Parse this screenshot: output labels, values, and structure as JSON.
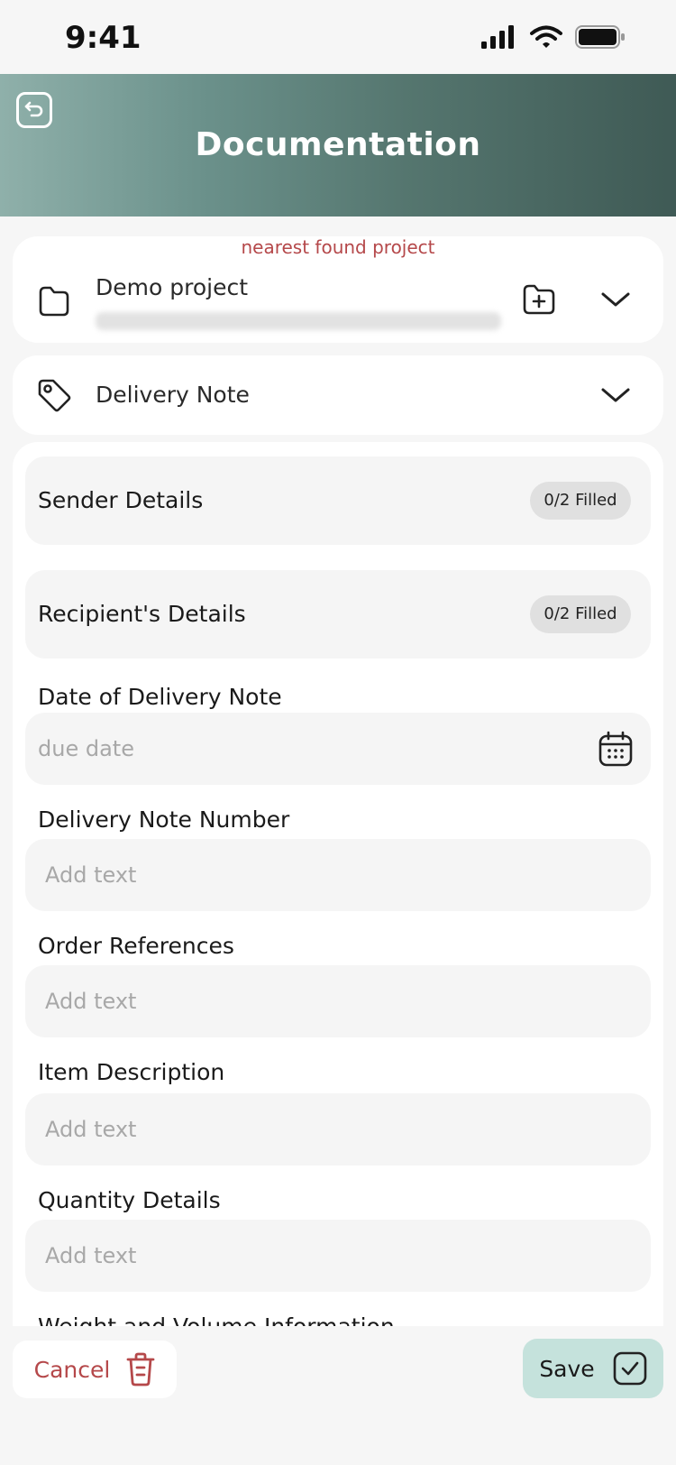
{
  "status_bar": {
    "time": "9:41"
  },
  "header": {
    "title": "Documentation"
  },
  "project": {
    "hint": "nearest found project",
    "name": "Demo project"
  },
  "category": {
    "name": "Delivery Note"
  },
  "sections": [
    {
      "title": "Sender Details",
      "badge": "0/2 Filled"
    },
    {
      "title": "Recipient's Details",
      "badge": "0/2 Filled"
    }
  ],
  "fields": {
    "date": {
      "label": "Date of Delivery Note",
      "placeholder": "due date"
    },
    "number": {
      "label": "Delivery Note Number",
      "placeholder": "Add text"
    },
    "order": {
      "label": "Order References",
      "placeholder": "Add text"
    },
    "item": {
      "label": "Item Description",
      "placeholder": "Add text"
    },
    "quantity": {
      "label": "Quantity Details",
      "placeholder": "Add text"
    },
    "weight": {
      "label": "Weight and Volume Information"
    }
  },
  "actions": {
    "cancel": "Cancel",
    "save": "Save"
  },
  "colors": {
    "accent_red": "#b5484a",
    "save_bg": "#c5e2dc",
    "header_dark": "#3f5a55"
  }
}
